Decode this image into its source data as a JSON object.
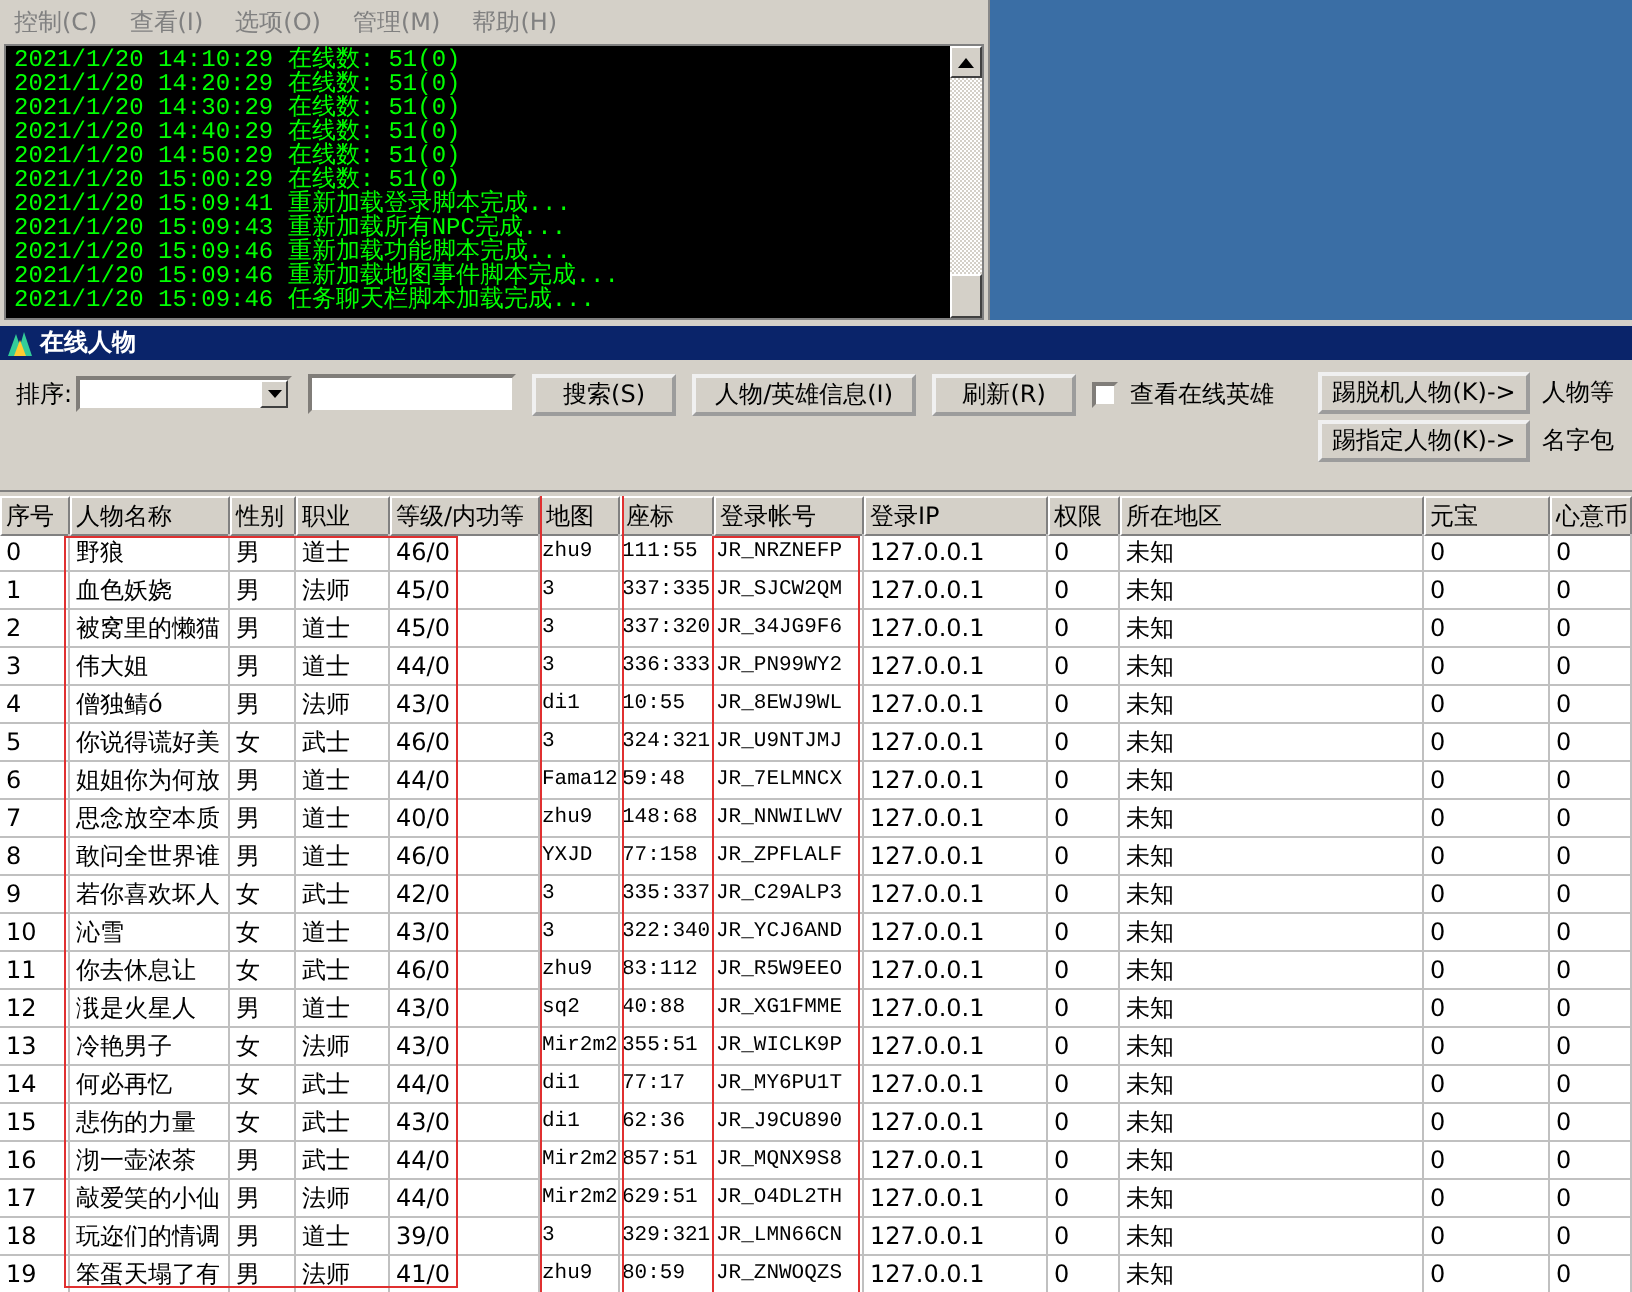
{
  "menu": [
    {
      "label": "控制(C)"
    },
    {
      "label": "查看(I)"
    },
    {
      "label": "选项(O)"
    },
    {
      "label": "管理(M)"
    },
    {
      "label": "帮助(H)"
    }
  ],
  "console": {
    "lines": [
      "2021/1/20 14:10:29 在线数: 51(0)",
      "2021/1/20 14:20:29 在线数: 51(0)",
      "2021/1/20 14:30:29 在线数: 51(0)",
      "2021/1/20 14:40:29 在线数: 51(0)",
      "2021/1/20 14:50:29 在线数: 51(0)",
      "2021/1/20 15:00:29 在线数: 51(0)",
      "2021/1/20 15:09:41 重新加载登录脚本完成...",
      "2021/1/20 15:09:43 重新加载所有NPC完成...",
      "2021/1/20 15:09:46 重新加载功能脚本完成...",
      "2021/1/20 15:09:46 重新加载地图事件脚本完成...",
      "2021/1/20 15:09:46 任务聊天栏脚本加载完成..."
    ]
  },
  "panel": {
    "title": "在线人物"
  },
  "toolbar": {
    "sort_label": "排序:",
    "search_button": "搜索(S)",
    "info_button": "人物/英雄信息(I)",
    "refresh_button": "刷新(R)",
    "hero_checkbox": {
      "label": "查看在线英雄",
      "checked": false
    },
    "kick_offline_button": "踢脱机人物(K)->",
    "level_label": "人物等",
    "kick_named_button": "踢指定人物(K)->",
    "name_label": "名字包"
  },
  "table": {
    "columns": [
      "序号",
      "人物名称",
      "性别",
      "职业",
      "等级/内功等",
      "地图",
      "座标",
      "登录帐号",
      "登录IP",
      "权限",
      "所在地区",
      "元宝",
      "心意币"
    ],
    "rows": [
      [
        "0",
        "野狼",
        "男",
        "道士",
        "46/0",
        "zhu9",
        "111:55",
        "JR_NRZNEFP",
        "127.0.0.1",
        "0",
        "未知",
        "0",
        "0"
      ],
      [
        "1",
        "血色妖娆",
        "男",
        "法师",
        "45/0",
        "3",
        "337:335",
        "JR_SJCW2QM",
        "127.0.0.1",
        "0",
        "未知",
        "0",
        "0"
      ],
      [
        "2",
        "被窝里的懒猫",
        "男",
        "道士",
        "45/0",
        "3",
        "337:320",
        "JR_34JG9F6",
        "127.0.0.1",
        "0",
        "未知",
        "0",
        "0"
      ],
      [
        "3",
        "伟大姐",
        "男",
        "道士",
        "44/0",
        "3",
        "336:333",
        "JR_PN99WY2",
        "127.0.0.1",
        "0",
        "未知",
        "0",
        "0"
      ],
      [
        "4",
        "僧独鲭ó",
        "男",
        "法师",
        "43/0",
        "di1",
        "10:55",
        "JR_8EWJ9WL",
        "127.0.0.1",
        "0",
        "未知",
        "0",
        "0"
      ],
      [
        "5",
        "你说得谎好美",
        "女",
        "武士",
        "46/0",
        "3",
        "324:321",
        "JR_U9NTJMJ",
        "127.0.0.1",
        "0",
        "未知",
        "0",
        "0"
      ],
      [
        "6",
        "姐姐你为何放",
        "男",
        "道士",
        "44/0",
        "Fama12",
        "59:48",
        "JR_7ELMNCX",
        "127.0.0.1",
        "0",
        "未知",
        "0",
        "0"
      ],
      [
        "7",
        "思念放空本质",
        "男",
        "道士",
        "40/0",
        "zhu9",
        "148:68",
        "JR_NNWILWV",
        "127.0.0.1",
        "0",
        "未知",
        "0",
        "0"
      ],
      [
        "8",
        "敢问全世界谁",
        "男",
        "道士",
        "46/0",
        "YXJD",
        "77:158",
        "JR_ZPFLALF",
        "127.0.0.1",
        "0",
        "未知",
        "0",
        "0"
      ],
      [
        "9",
        "若你喜欢坏人",
        "女",
        "武士",
        "42/0",
        "3",
        "335:337",
        "JR_C29ALP3",
        "127.0.0.1",
        "0",
        "未知",
        "0",
        "0"
      ],
      [
        "10",
        "沁雪",
        "女",
        "道士",
        "43/0",
        "3",
        "322:340",
        "JR_YCJ6AND",
        "127.0.0.1",
        "0",
        "未知",
        "0",
        "0"
      ],
      [
        "11",
        "你去休息让",
        "女",
        "武士",
        "46/0",
        "zhu9",
        "83:112",
        "JR_R5W9EEO",
        "127.0.0.1",
        "0",
        "未知",
        "0",
        "0"
      ],
      [
        "12",
        "涐是火星人",
        "男",
        "道士",
        "43/0",
        "sq2",
        "40:88",
        "JR_XG1FMME",
        "127.0.0.1",
        "0",
        "未知",
        "0",
        "0"
      ],
      [
        "13",
        "冷艳男子",
        "女",
        "法师",
        "43/0",
        "Mir2m2",
        "355:51",
        "JR_WICLK9P",
        "127.0.0.1",
        "0",
        "未知",
        "0",
        "0"
      ],
      [
        "14",
        "何必再忆",
        "女",
        "武士",
        "44/0",
        "di1",
        "77:17",
        "JR_MY6PU1T",
        "127.0.0.1",
        "0",
        "未知",
        "0",
        "0"
      ],
      [
        "15",
        "悲伤的力量",
        "女",
        "武士",
        "43/0",
        "di1",
        "62:36",
        "JR_J9CU890",
        "127.0.0.1",
        "0",
        "未知",
        "0",
        "0"
      ],
      [
        "16",
        "沏一壶浓茶",
        "男",
        "武士",
        "44/0",
        "Mir2m2",
        "857:51",
        "JR_MQNX9S8",
        "127.0.0.1",
        "0",
        "未知",
        "0",
        "0"
      ],
      [
        "17",
        "敲爱笑的小仙",
        "男",
        "法师",
        "44/0",
        "Mir2m2",
        "629:51",
        "JR_O4DL2TH",
        "127.0.0.1",
        "0",
        "未知",
        "0",
        "0"
      ],
      [
        "18",
        "玩迩们的情调",
        "男",
        "道士",
        "39/0",
        "3",
        "329:321",
        "JR_LMN66CN",
        "127.0.0.1",
        "0",
        "未知",
        "0",
        "0"
      ],
      [
        "19",
        "笨蛋天塌了有",
        "男",
        "法师",
        "41/0",
        "zhu9",
        "80:59",
        "JR_ZNWOQZS",
        "127.0.0.1",
        "0",
        "未知",
        "0",
        "0"
      ]
    ]
  }
}
